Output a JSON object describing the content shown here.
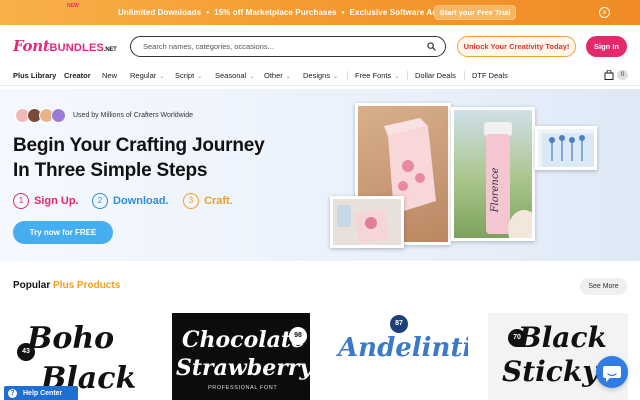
{
  "promo": {
    "text_1": "Unlimited Downloads",
    "text_2": "15% off Marketplace Purchases",
    "text_3": "Exclusive Software Access",
    "separator": "•",
    "cta_label": "Start your Free Trial",
    "close_icon": "close-icon"
  },
  "header": {
    "logo_part_1": "Font",
    "logo_part_2": "BUNDLES",
    "logo_part_3": ".NET",
    "search_placeholder": "Search names, categories, occasions...",
    "unlock_label": "Unlock Your Creativity Today!",
    "signin_label": "Sign In"
  },
  "nav": {
    "items": [
      "Plus Library",
      "Creator",
      "New",
      "Regular",
      "Script",
      "Seasonal",
      "Other",
      "Designs",
      "Free Fonts",
      "Dollar Deals",
      "DTF Deals"
    ],
    "new_badge": "NEW",
    "chevron": "⌄",
    "cart_count": "0"
  },
  "hero": {
    "trust_text": "Used by Millions of Crafters Worldwide",
    "title_line_1": "Begin Your Crafting Journey",
    "title_line_2": "In Three Simple Steps",
    "steps": [
      {
        "num": "1",
        "label": "Sign Up.",
        "color": "#e5286c"
      },
      {
        "num": "2",
        "label": "Download.",
        "color": "#2b8fd9"
      },
      {
        "num": "3",
        "label": "Craft.",
        "color": "#f0a01c"
      }
    ],
    "cta_label": "Try now for FREE",
    "tumbler_text": "Florence"
  },
  "popular": {
    "title_prefix": "Popular",
    "title_accent": "Plus Products",
    "see_more_label": "See More",
    "cards": [
      {
        "line_1": "Boho",
        "line_2": "Black",
        "badge": "43"
      },
      {
        "line_1": "Chocolate",
        "line_2": "Strawberry",
        "badge": "98",
        "tag": "PROFESSIONAL FONT"
      },
      {
        "line_1": "Andelintia",
        "badge": "87"
      },
      {
        "line_1": "Black",
        "line_2": "Sticky",
        "badge": "70"
      }
    ]
  },
  "help": {
    "label": "Help Center",
    "icon": "?"
  },
  "colors": {
    "brand_pink": "#e5286c",
    "promo_orange": "#f49a2f",
    "cta_blue": "#45aef0",
    "accent_gold": "#f0a01c"
  }
}
